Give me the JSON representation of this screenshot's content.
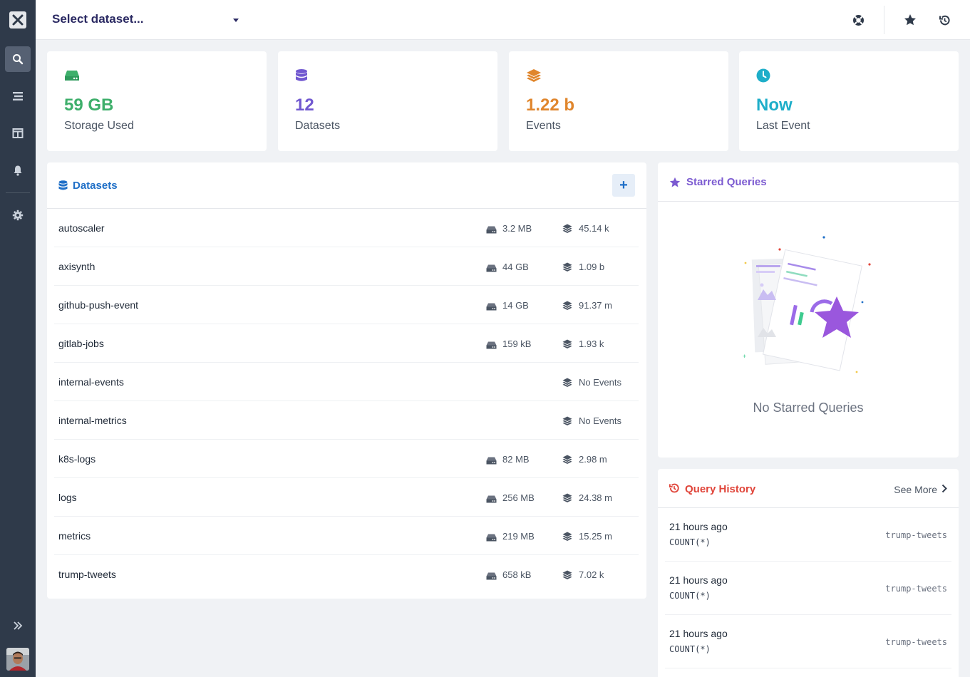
{
  "topbar": {
    "dataset_select": "Select dataset..."
  },
  "stats": [
    {
      "value": "59 GB",
      "label": "Storage Used",
      "color": "#3eaf6b",
      "icon": "hard-drive-icon"
    },
    {
      "value": "12",
      "label": "Datasets",
      "color": "#7158d0",
      "icon": "database-icon"
    },
    {
      "value": "1.22 b",
      "label": "Events",
      "color": "#e0862d",
      "icon": "layers-icon"
    },
    {
      "value": "Now",
      "label": "Last Event",
      "color": "#1eaec9",
      "icon": "clock-icon"
    }
  ],
  "datasets_panel": {
    "title": "Datasets",
    "add_label": "+",
    "rows": [
      {
        "name": "autoscaler",
        "size": "3.2 MB",
        "events": "45.14 k"
      },
      {
        "name": "axisynth",
        "size": "44 GB",
        "events": "1.09 b"
      },
      {
        "name": "github-push-event",
        "size": "14 GB",
        "events": "91.37 m"
      },
      {
        "name": "gitlab-jobs",
        "size": "159 kB",
        "events": "1.93 k"
      },
      {
        "name": "internal-events",
        "size": "",
        "events": "No Events"
      },
      {
        "name": "internal-metrics",
        "size": "",
        "events": "No Events"
      },
      {
        "name": "k8s-logs",
        "size": "82 MB",
        "events": "2.98 m"
      },
      {
        "name": "logs",
        "size": "256 MB",
        "events": "24.38 m"
      },
      {
        "name": "metrics",
        "size": "219 MB",
        "events": "15.25 m"
      },
      {
        "name": "trump-tweets",
        "size": "658 kB",
        "events": "7.02 k"
      }
    ]
  },
  "starred_panel": {
    "title": "Starred Queries",
    "empty_text": "No Starred Queries"
  },
  "history_panel": {
    "title": "Query History",
    "see_more": "See More",
    "rows": [
      {
        "time": "21 hours ago",
        "query": "COUNT(*)",
        "dataset": "trump-tweets"
      },
      {
        "time": "21 hours ago",
        "query": "COUNT(*)",
        "dataset": "trump-tweets"
      },
      {
        "time": "21 hours ago",
        "query": "COUNT(*)",
        "dataset": "trump-tweets"
      }
    ]
  },
  "sidebar": {
    "items": [
      "search-icon",
      "stream-icon",
      "dashboard-icon",
      "bell-icon",
      "gear-icon"
    ]
  }
}
